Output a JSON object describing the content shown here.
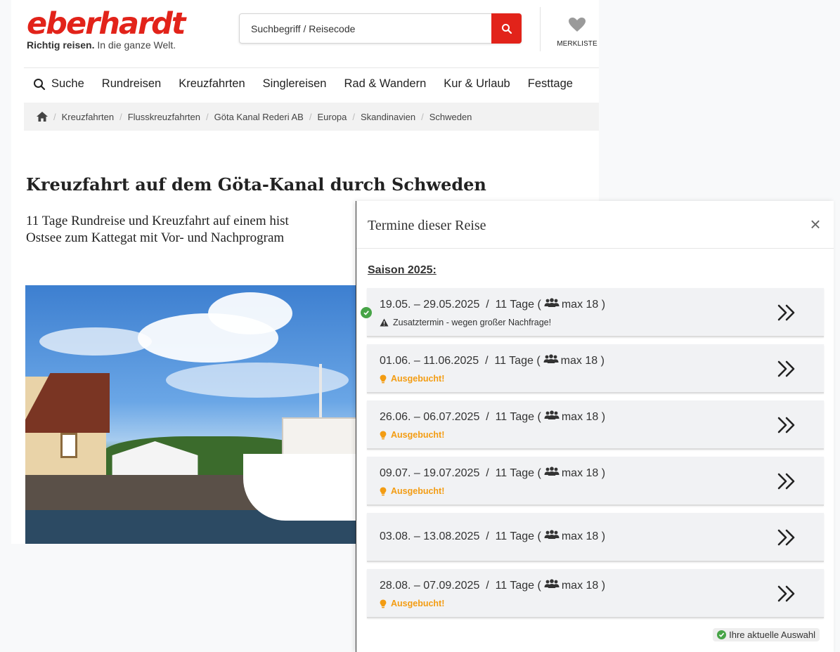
{
  "header": {
    "logo_text": "eberhardt",
    "tagline_bold": "Richtig reisen.",
    "tagline_rest": " In die ganze Welt.",
    "search_placeholder": "Suchbegriff / Reisecode",
    "wishlist_label": "MERKLISTE"
  },
  "nav": {
    "search_label": "Suche",
    "items": [
      "Rundreisen",
      "Kreuzfahrten",
      "Singlereisen",
      "Rad & Wandern",
      "Kur & Urlaub",
      "Festtage"
    ]
  },
  "breadcrumb": [
    "Kreuzfahrten",
    "Flusskreuzfahrten",
    "Göta Kanal Rederi AB",
    "Europa",
    "Skandinavien",
    "Schweden"
  ],
  "main": {
    "title": "Kreuzfahrt auf dem Göta-Kanal durch Schweden",
    "subtitle_line1": "11 Tage Rundreise und Kreuzfahrt auf einem hist",
    "subtitle_line2": "Ostsee zum Kattegat mit Vor- und Nachprogram"
  },
  "modal": {
    "title": "Termine dieser Reise",
    "close_symbol": "×",
    "season_label": "Saison 2025:",
    "dates": [
      {
        "range": "19.05. – 29.05.2025",
        "duration": "11 Tage",
        "max": "max 18",
        "note": "Zusatztermin - wegen großer Nachfrage!",
        "note_type": "warn",
        "selected": true
      },
      {
        "range": "01.06. – 11.06.2025",
        "duration": "11 Tage",
        "max": "max 18",
        "note": "Ausgebucht!",
        "note_type": "booked",
        "selected": false
      },
      {
        "range": "26.06. – 06.07.2025",
        "duration": "11 Tage",
        "max": "max 18",
        "note": "Ausgebucht!",
        "note_type": "booked",
        "selected": false
      },
      {
        "range": "09.07. – 19.07.2025",
        "duration": "11 Tage",
        "max": "max 18",
        "note": "Ausgebucht!",
        "note_type": "booked",
        "selected": false
      },
      {
        "range": "03.08. – 13.08.2025",
        "duration": "11 Tage",
        "max": "max 18",
        "note": "",
        "note_type": "none",
        "selected": false
      },
      {
        "range": "28.08. – 07.09.2025",
        "duration": "11 Tage",
        "max": "max 18",
        "note": "Ausgebucht!",
        "note_type": "booked",
        "selected": false
      }
    ],
    "legend_label": "Ihre aktuelle Auswahl"
  },
  "colors": {
    "brand_red": "#e2231a",
    "booked_orange": "#f39c12",
    "selected_green": "#47a447"
  }
}
